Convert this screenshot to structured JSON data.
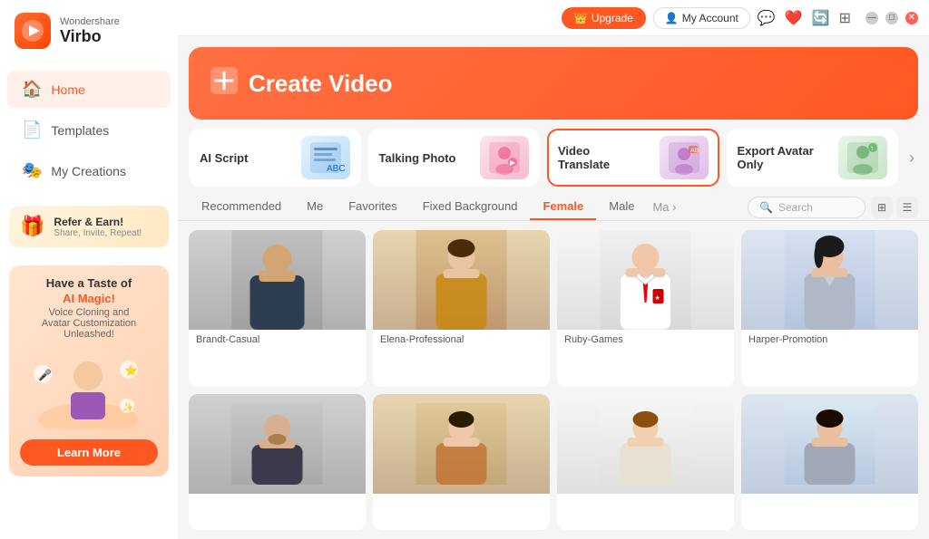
{
  "app": {
    "brand": "Wondershare",
    "name": "Virbo",
    "logo_emoji": "🎬"
  },
  "titlebar": {
    "upgrade_label": "Upgrade",
    "account_label": "My Account",
    "crown": "👑"
  },
  "sidebar": {
    "nav_items": [
      {
        "id": "home",
        "label": "Home",
        "icon": "🏠",
        "active": true
      },
      {
        "id": "templates",
        "label": "Templates",
        "icon": "📄",
        "active": false
      },
      {
        "id": "my-creations",
        "label": "My Creations",
        "icon": "🎭",
        "active": false
      }
    ],
    "refer_title": "Refer & Earn!",
    "refer_sub": "Share, Invite, Repeat!",
    "promo_title": "Have a Taste of",
    "promo_highlight": "AI Magic!",
    "promo_sub": "Voice Cloning and\nAvatar Customization Unleashed!",
    "learn_more": "Learn More"
  },
  "banner": {
    "icon": "➕",
    "label": "Create Video"
  },
  "feature_cards": [
    {
      "id": "ai-script",
      "label": "AI Script",
      "emoji": "📝",
      "selected": false
    },
    {
      "id": "talking-photo",
      "label": "Talking Photo",
      "emoji": "🖼️",
      "selected": false
    },
    {
      "id": "video-translate",
      "label": "Video\nTranslate",
      "emoji": "🌐",
      "selected": true
    },
    {
      "id": "export-avatar",
      "label": "Export Avatar Only",
      "emoji": "👤",
      "selected": false
    }
  ],
  "tabs": [
    {
      "id": "recommended",
      "label": "Recommended",
      "active": false
    },
    {
      "id": "me",
      "label": "Me",
      "active": false
    },
    {
      "id": "favorites",
      "label": "Favorites",
      "active": false
    },
    {
      "id": "fixed-background",
      "label": "Fixed Background",
      "active": false
    },
    {
      "id": "female",
      "label": "Female",
      "active": true
    },
    {
      "id": "male",
      "label": "Male",
      "active": false
    },
    {
      "id": "more",
      "label": "Ma",
      "active": false
    }
  ],
  "search": {
    "placeholder": "Search"
  },
  "avatars": [
    {
      "id": 1,
      "name": "Brandt-Casual",
      "bg": "bg-gray"
    },
    {
      "id": 2,
      "name": "Elena-Professional",
      "bg": "bg-beige"
    },
    {
      "id": 3,
      "name": "Ruby-Games",
      "bg": "bg-white"
    },
    {
      "id": 4,
      "name": "Harper-Promotion",
      "bg": "bg-light"
    },
    {
      "id": 5,
      "name": "",
      "bg": "bg-gray"
    },
    {
      "id": 6,
      "name": "",
      "bg": "bg-beige"
    },
    {
      "id": 7,
      "name": "",
      "bg": "bg-white"
    },
    {
      "id": 8,
      "name": "",
      "bg": "bg-light"
    }
  ],
  "avatar_colors": {
    "bg-gray": [
      "#c8c8c8",
      "#a8a8a8"
    ],
    "bg-beige": [
      "#e0c898",
      "#c0a878"
    ],
    "bg-white": [
      "#f0f0f0",
      "#d8d8d8"
    ],
    "bg-light": [
      "#d8e0f0",
      "#b8c8e0"
    ]
  },
  "window_controls": {
    "minimize": "—",
    "maximize": "□",
    "close": "✕"
  }
}
